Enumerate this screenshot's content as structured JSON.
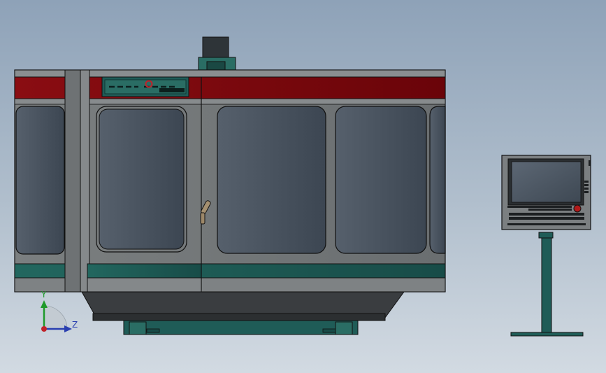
{
  "viewport": {
    "type": "cad-3d-viewport",
    "background": [
      "#8ea2b8",
      "#d2dae2"
    ]
  },
  "model": {
    "machine": {
      "body_color": "#75797a",
      "stripe_top_color": "#7a0a0f",
      "stripe_bottom_color": "#1f5c57",
      "window_color": "#4a5564"
    },
    "control_pendant": {
      "screen_color": "#4e5965",
      "stand_color": "#1f5c57",
      "estop_color": "#b01a1a"
    }
  },
  "triad": {
    "y_label": "Y",
    "z_label": "Z",
    "colors": {
      "y": "#1f9a2a",
      "z": "#2a3fb0",
      "x": "#c0232a"
    }
  }
}
